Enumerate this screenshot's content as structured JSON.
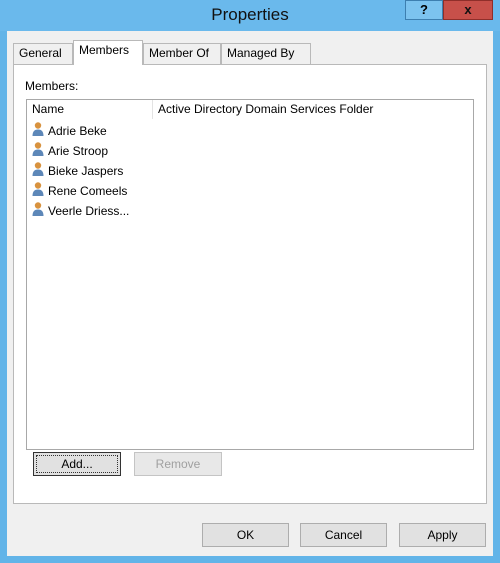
{
  "window": {
    "title": "Properties",
    "help_label": "?",
    "close_label": "x"
  },
  "tabs": [
    {
      "label": "General"
    },
    {
      "label": "Members"
    },
    {
      "label": "Member Of"
    },
    {
      "label": "Managed By"
    }
  ],
  "members": {
    "label": "Members:",
    "columns": [
      "Name",
      "Active Directory Domain Services Folder"
    ],
    "rows": [
      {
        "name": "Adrie Beke",
        "folder": ""
      },
      {
        "name": "Arie Stroop",
        "folder": ""
      },
      {
        "name": "Bieke Jaspers",
        "folder": ""
      },
      {
        "name": "Rene Comeels",
        "folder": ""
      },
      {
        "name": "Veerle Driess...",
        "folder": ""
      }
    ],
    "row_icon": "user-icon"
  },
  "buttons": {
    "add": "Add...",
    "remove": "Remove",
    "ok": "OK",
    "cancel": "Cancel",
    "apply": "Apply"
  }
}
